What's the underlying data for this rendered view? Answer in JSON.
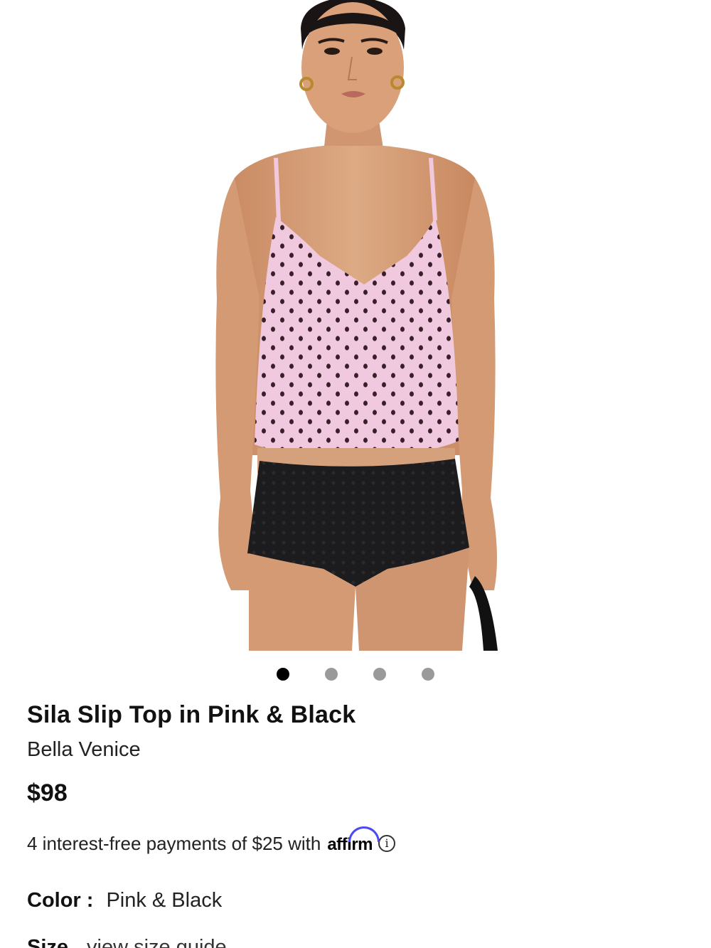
{
  "product": {
    "title": "Sila Slip Top in Pink & Black",
    "brand": "Bella Venice",
    "price": "$98",
    "installments_text": "4 interest-free payments of $25 with",
    "affirm_label": "affirm",
    "info_icon": "i",
    "color_label": "Color :",
    "color_value": "Pink & Black",
    "size_label": "Size",
    "size_guide_label": "view size guide"
  },
  "carousel": {
    "total": 4,
    "active_index": 0
  },
  "colors": {
    "active_dot": "#000000",
    "inactive_dot": "#9a9a9a",
    "affirm_arc": "#4a4af4",
    "top_fabric": "#f1c9df",
    "polka_dot": "#3a1f2a",
    "shorts": "#1c1c1e",
    "skin": "#d9a07a"
  }
}
